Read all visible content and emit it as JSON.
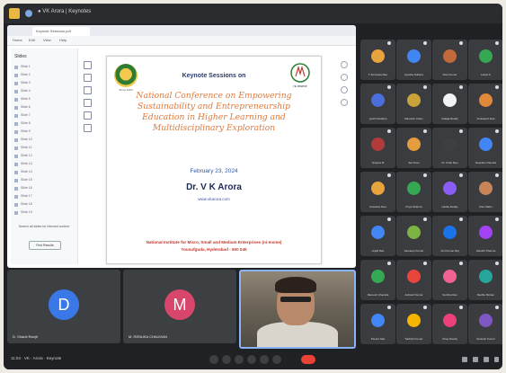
{
  "meeting": {
    "window_title": "● VK Arora | Keynotes",
    "time_label": "11:04 · VK · Arora · Keynote",
    "accent": "#8ab4f8",
    "end_call_color": "#ea4335"
  },
  "presentation": {
    "tab_label": "Keynote Sessions.pdf",
    "menu": [
      "Home",
      "Edit",
      "View",
      "Help"
    ],
    "thumbnails_header": "Slides",
    "thumbnails": [
      "Slide 1",
      "Slide 2",
      "Slide 3",
      "Slide 4",
      "Slide 5",
      "Slide 6",
      "Slide 7",
      "Slide 8",
      "Slide 9",
      "Slide 10",
      "Slide 11",
      "Slide 12",
      "Slide 13",
      "Slide 14",
      "Slide 15",
      "Slide 16",
      "Slide 17",
      "Slide 18",
      "Slide 19"
    ],
    "side_note": "Search all slides for relevant content",
    "side_button": "Find Results"
  },
  "slide": {
    "kicker": "Keynote Sessions on",
    "conference_lines": [
      "National Conference on Empowering",
      "Sustainability and Entrepreneurship",
      "Education in Higher Learning and",
      "Multidisciplinary Exploration"
    ],
    "date": "February 23, 2024",
    "speaker": "Dr. V K Arora",
    "website": "www.vkarora.com",
    "institute": "National Institute for Micro, Small and Medium Enterprises (ni-msme)",
    "address": "Yousufguda, Hyderabad - 500 045",
    "logo_left_caption": "Since 1960",
    "logo_right_caption": "ni-msme"
  },
  "participants": [
    {
      "name": "T Srinivasa Rao",
      "color": "#e8a33d"
    },
    {
      "name": "Ayesha Sultana",
      "color": "#4285f4"
    },
    {
      "name": "Ravi Kumar",
      "color": "#c26a3a"
    },
    {
      "name": "Lahari K",
      "color": "#34a853"
    },
    {
      "name": "Jyothi Vardhan",
      "color": "#4a6fdc"
    },
    {
      "name": "Manohar Chary",
      "color": "#c9a23a"
    },
    {
      "name": "Sailaja Reddy",
      "color": "#f1f3f4"
    },
    {
      "name": "Venkatesh Rao",
      "color": "#e0893a"
    },
    {
      "name": "Srujana M",
      "color": "#b23a3a"
    },
    {
      "name": "Sai Kiran",
      "color": "#e59c3e"
    },
    {
      "name": "Dr. Kiran Rao",
      "color": "#3c4043"
    },
    {
      "name": "Deepika Chandra",
      "color": "#4285f4"
    },
    {
      "name": "Sireesha Devi",
      "color": "#e8a33d"
    },
    {
      "name": "Priya Sharma",
      "color": "#34a853"
    },
    {
      "name": "Harika Reddy",
      "color": "#8b5cf6"
    },
    {
      "name": "Ram Babu",
      "color": "#c9855a"
    },
    {
      "name": "Anjali Rao",
      "color": "#4285f4"
    },
    {
      "name": "Sandeep Kumar",
      "color": "#7cb342"
    },
    {
      "name": "Anil Kumar Raj",
      "color": "#1a73e8"
    },
    {
      "name": "Nandini Sharma",
      "color": "#a142f4"
    },
    {
      "name": "Ramesh Chandra",
      "color": "#34a853"
    },
    {
      "name": "Ashwini Kumar",
      "color": "#e8453c"
    },
    {
      "name": "Sunitha Rao",
      "color": "#f06292"
    },
    {
      "name": "Madhu Mohan",
      "color": "#26a69a"
    },
    {
      "name": "Pavani Nair",
      "color": "#4285f4"
    },
    {
      "name": "Sathish Kumar",
      "color": "#f4b400"
    },
    {
      "name": "Vinay Reddy",
      "color": "#ec407a"
    },
    {
      "name": "Santosh Kumar",
      "color": "#7e57c2"
    }
  ],
  "bottom_tiles": [
    {
      "initial": "D",
      "name": "D. Shanti Ranjit",
      "color": "#3b78e7"
    },
    {
      "initial": "M",
      "name": "M. RENUKA CHAUHAN",
      "color": "#d9466b"
    }
  ]
}
